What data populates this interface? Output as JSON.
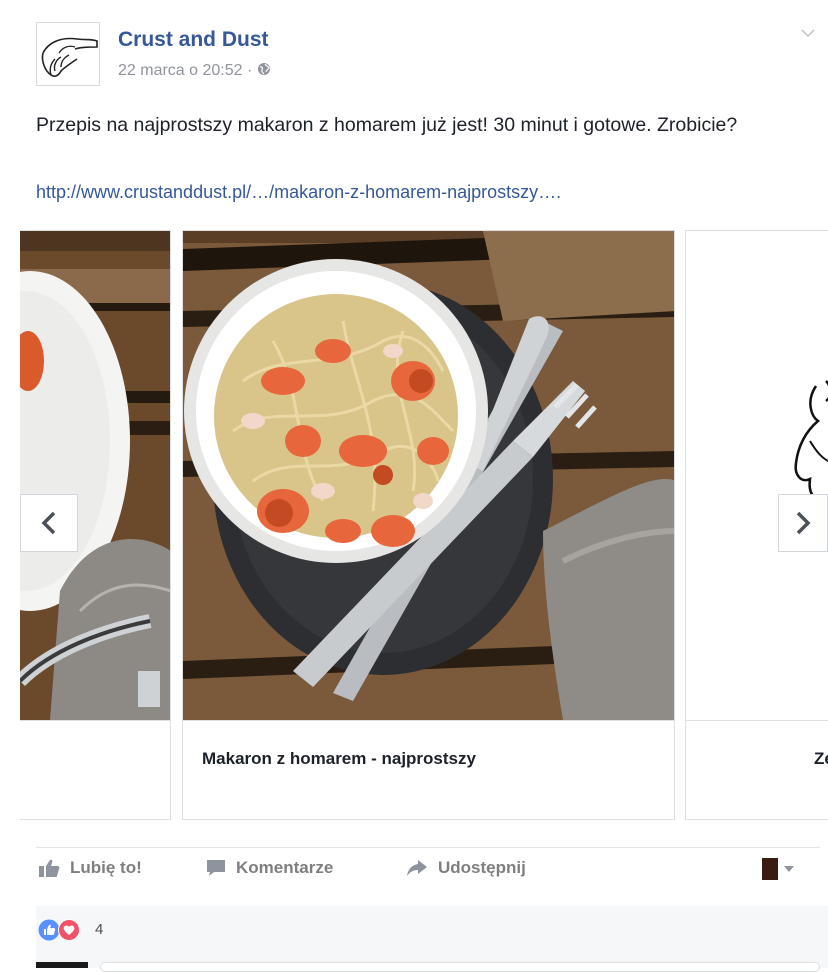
{
  "post": {
    "page_name": "Crust and Dust",
    "timestamp": "22 marca o 20:52 ·",
    "privacy_icon": "globe-icon",
    "text": "Przepis na najprostszy makaron z homarem już jest! 30 minut i gotowe. Zrobicie?",
    "link": "http://www.crustanddust.pl/…/makaron-z-homarem-najprostszy…."
  },
  "carousel": {
    "cards": [
      {
        "title": ""
      },
      {
        "title": "Makaron z homarem - najprostszy"
      },
      {
        "title": "Ze"
      }
    ],
    "prev_icon": "chevron-left-icon",
    "next_icon": "chevron-right-icon"
  },
  "actions": {
    "like": "Lubię to!",
    "comment": "Komentarze",
    "share": "Udostępnij"
  },
  "reactions": {
    "count": "4",
    "icons": [
      "like-icon",
      "love-icon"
    ]
  },
  "colors": {
    "link": "#365899",
    "text": "#1d2129",
    "muted": "#90949c",
    "like_blue": "#5890ff",
    "love_red": "#f25268"
  }
}
